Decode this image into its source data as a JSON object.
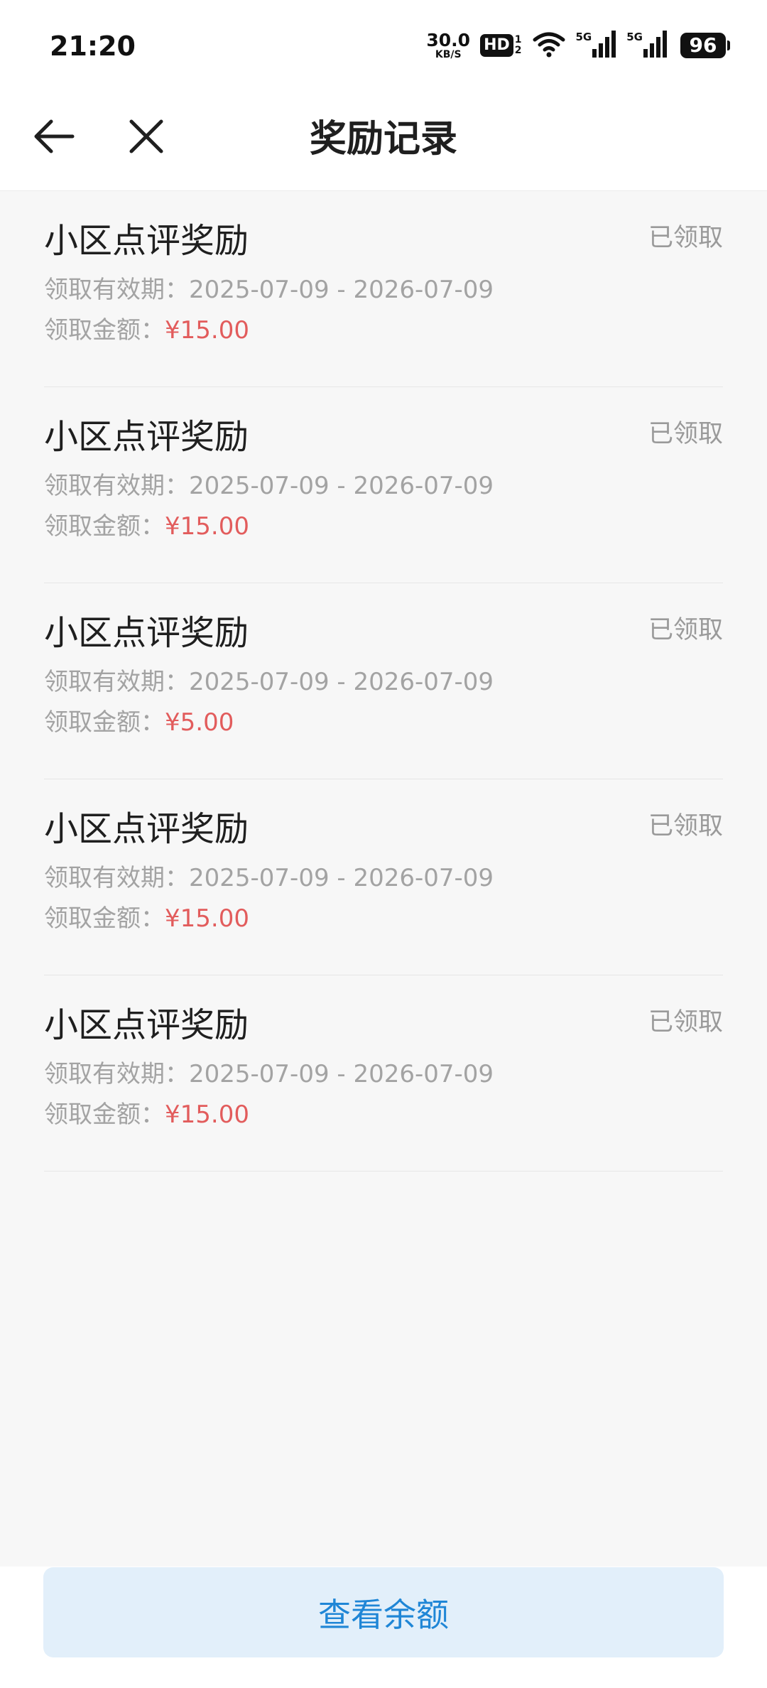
{
  "status_bar": {
    "time": "21:20",
    "net_speed_value": "30.0",
    "net_speed_unit": "KB/S",
    "hd_label": "HD",
    "hd_sub_top": "1",
    "hd_sub_bottom": "2",
    "signal1_label": "5G",
    "signal2_label": "5G",
    "battery": "96"
  },
  "header": {
    "title": "奖励记录"
  },
  "records": [
    {
      "title": "小区点评奖励",
      "status": "已领取",
      "validity_label": "领取有效期：",
      "validity_value": "2025-07-09 - 2026-07-09",
      "amount_label": "领取金额：",
      "amount_value": "¥15.00"
    },
    {
      "title": "小区点评奖励",
      "status": "已领取",
      "validity_label": "领取有效期：",
      "validity_value": "2025-07-09 - 2026-07-09",
      "amount_label": "领取金额：",
      "amount_value": "¥15.00"
    },
    {
      "title": "小区点评奖励",
      "status": "已领取",
      "validity_label": "领取有效期：",
      "validity_value": "2025-07-09 - 2026-07-09",
      "amount_label": "领取金额：",
      "amount_value": "¥5.00"
    },
    {
      "title": "小区点评奖励",
      "status": "已领取",
      "validity_label": "领取有效期：",
      "validity_value": "2025-07-09 - 2026-07-09",
      "amount_label": "领取金额：",
      "amount_value": "¥15.00"
    },
    {
      "title": "小区点评奖励",
      "status": "已领取",
      "validity_label": "领取有效期：",
      "validity_value": "2025-07-09 - 2026-07-09",
      "amount_label": "领取金额：",
      "amount_value": "¥15.00"
    }
  ],
  "footer": {
    "balance_button": "查看余额"
  },
  "colors": {
    "amount": "#e25c5c",
    "button_bg": "#e2effa",
    "button_text": "#1f86d6"
  },
  "icons": {
    "back": "arrow-left-icon",
    "close": "close-icon",
    "wifi": "wifi-icon",
    "signal": "signal-icon"
  }
}
